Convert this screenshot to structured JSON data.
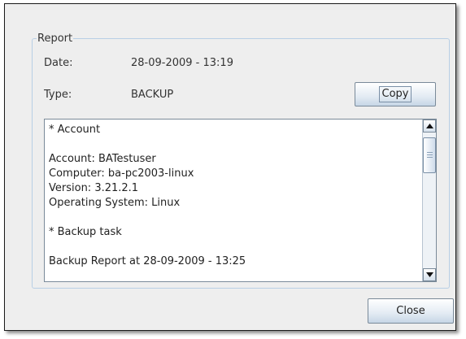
{
  "report": {
    "group_title": "Report",
    "date_label": "Date:",
    "date_value": "28-09-2009 - 13:19",
    "type_label": "Type:",
    "type_value": "BACKUP",
    "copy_label": "Copy",
    "content_lines": [
      "* Account",
      "",
      "Account: BATestuser",
      "Computer: ba-pc2003-linux",
      "Version: 3.21.2.1",
      "Operating System: Linux",
      "",
      "* Backup task",
      "",
      "Backup Report at 28-09-2009 - 13:25"
    ],
    "scroll_position": 0.05
  },
  "footer": {
    "close_label": "Close"
  },
  "colors": {
    "window_bg": "#eeeeee",
    "group_border": "#b8cfe5",
    "button_border": "#7a8a99"
  }
}
